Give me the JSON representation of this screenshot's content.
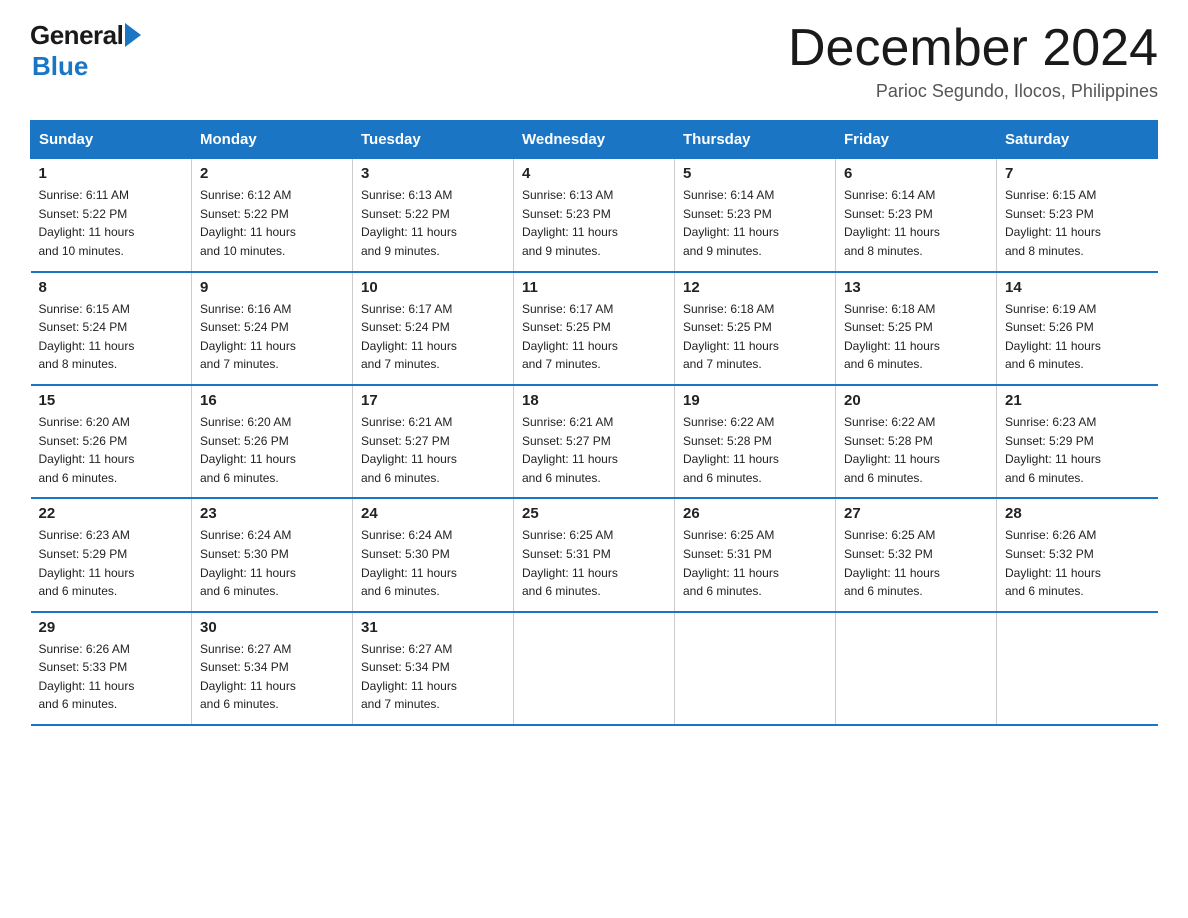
{
  "header": {
    "logo_general": "General",
    "logo_blue": "Blue",
    "month_title": "December 2024",
    "subtitle": "Parioc Segundo, Ilocos, Philippines"
  },
  "days_of_week": [
    "Sunday",
    "Monday",
    "Tuesday",
    "Wednesday",
    "Thursday",
    "Friday",
    "Saturday"
  ],
  "weeks": [
    [
      {
        "day": "1",
        "sunrise": "6:11 AM",
        "sunset": "5:22 PM",
        "daylight": "11 hours and 10 minutes."
      },
      {
        "day": "2",
        "sunrise": "6:12 AM",
        "sunset": "5:22 PM",
        "daylight": "11 hours and 10 minutes."
      },
      {
        "day": "3",
        "sunrise": "6:13 AM",
        "sunset": "5:22 PM",
        "daylight": "11 hours and 9 minutes."
      },
      {
        "day": "4",
        "sunrise": "6:13 AM",
        "sunset": "5:23 PM",
        "daylight": "11 hours and 9 minutes."
      },
      {
        "day": "5",
        "sunrise": "6:14 AM",
        "sunset": "5:23 PM",
        "daylight": "11 hours and 9 minutes."
      },
      {
        "day": "6",
        "sunrise": "6:14 AM",
        "sunset": "5:23 PM",
        "daylight": "11 hours and 8 minutes."
      },
      {
        "day": "7",
        "sunrise": "6:15 AM",
        "sunset": "5:23 PM",
        "daylight": "11 hours and 8 minutes."
      }
    ],
    [
      {
        "day": "8",
        "sunrise": "6:15 AM",
        "sunset": "5:24 PM",
        "daylight": "11 hours and 8 minutes."
      },
      {
        "day": "9",
        "sunrise": "6:16 AM",
        "sunset": "5:24 PM",
        "daylight": "11 hours and 7 minutes."
      },
      {
        "day": "10",
        "sunrise": "6:17 AM",
        "sunset": "5:24 PM",
        "daylight": "11 hours and 7 minutes."
      },
      {
        "day": "11",
        "sunrise": "6:17 AM",
        "sunset": "5:25 PM",
        "daylight": "11 hours and 7 minutes."
      },
      {
        "day": "12",
        "sunrise": "6:18 AM",
        "sunset": "5:25 PM",
        "daylight": "11 hours and 7 minutes."
      },
      {
        "day": "13",
        "sunrise": "6:18 AM",
        "sunset": "5:25 PM",
        "daylight": "11 hours and 6 minutes."
      },
      {
        "day": "14",
        "sunrise": "6:19 AM",
        "sunset": "5:26 PM",
        "daylight": "11 hours and 6 minutes."
      }
    ],
    [
      {
        "day": "15",
        "sunrise": "6:20 AM",
        "sunset": "5:26 PM",
        "daylight": "11 hours and 6 minutes."
      },
      {
        "day": "16",
        "sunrise": "6:20 AM",
        "sunset": "5:26 PM",
        "daylight": "11 hours and 6 minutes."
      },
      {
        "day": "17",
        "sunrise": "6:21 AM",
        "sunset": "5:27 PM",
        "daylight": "11 hours and 6 minutes."
      },
      {
        "day": "18",
        "sunrise": "6:21 AM",
        "sunset": "5:27 PM",
        "daylight": "11 hours and 6 minutes."
      },
      {
        "day": "19",
        "sunrise": "6:22 AM",
        "sunset": "5:28 PM",
        "daylight": "11 hours and 6 minutes."
      },
      {
        "day": "20",
        "sunrise": "6:22 AM",
        "sunset": "5:28 PM",
        "daylight": "11 hours and 6 minutes."
      },
      {
        "day": "21",
        "sunrise": "6:23 AM",
        "sunset": "5:29 PM",
        "daylight": "11 hours and 6 minutes."
      }
    ],
    [
      {
        "day": "22",
        "sunrise": "6:23 AM",
        "sunset": "5:29 PM",
        "daylight": "11 hours and 6 minutes."
      },
      {
        "day": "23",
        "sunrise": "6:24 AM",
        "sunset": "5:30 PM",
        "daylight": "11 hours and 6 minutes."
      },
      {
        "day": "24",
        "sunrise": "6:24 AM",
        "sunset": "5:30 PM",
        "daylight": "11 hours and 6 minutes."
      },
      {
        "day": "25",
        "sunrise": "6:25 AM",
        "sunset": "5:31 PM",
        "daylight": "11 hours and 6 minutes."
      },
      {
        "day": "26",
        "sunrise": "6:25 AM",
        "sunset": "5:31 PM",
        "daylight": "11 hours and 6 minutes."
      },
      {
        "day": "27",
        "sunrise": "6:25 AM",
        "sunset": "5:32 PM",
        "daylight": "11 hours and 6 minutes."
      },
      {
        "day": "28",
        "sunrise": "6:26 AM",
        "sunset": "5:32 PM",
        "daylight": "11 hours and 6 minutes."
      }
    ],
    [
      {
        "day": "29",
        "sunrise": "6:26 AM",
        "sunset": "5:33 PM",
        "daylight": "11 hours and 6 minutes."
      },
      {
        "day": "30",
        "sunrise": "6:27 AM",
        "sunset": "5:34 PM",
        "daylight": "11 hours and 6 minutes."
      },
      {
        "day": "31",
        "sunrise": "6:27 AM",
        "sunset": "5:34 PM",
        "daylight": "11 hours and 7 minutes."
      },
      null,
      null,
      null,
      null
    ]
  ],
  "labels": {
    "sunrise_prefix": "Sunrise: ",
    "sunset_prefix": "Sunset: ",
    "daylight_prefix": "Daylight: "
  }
}
